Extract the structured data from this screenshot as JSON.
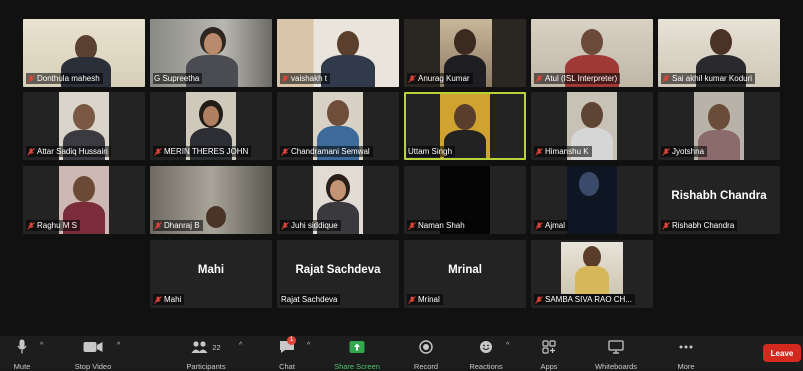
{
  "participants": [
    {
      "name": "Donthula mahesh",
      "muted": true
    },
    {
      "name": "G Supreetha",
      "muted": false
    },
    {
      "name": "vaishakh t",
      "muted": true
    },
    {
      "name": "Anurag Kumar",
      "muted": true
    },
    {
      "name": "Atul (ISL Interpreter)",
      "muted": true
    },
    {
      "name": "Sai akhil kumar Koduri",
      "muted": true
    },
    {
      "name": "Attar Sadiq Hussain",
      "muted": true
    },
    {
      "name": "MERIN THERES JOHN",
      "muted": true
    },
    {
      "name": "Chandramani Semwal",
      "muted": true
    },
    {
      "name": "Uttam Singh",
      "muted": false,
      "active_speaker": true
    },
    {
      "name": "Himanshu K",
      "muted": true
    },
    {
      "name": "Jyotshna",
      "muted": true
    },
    {
      "name": "Raghu M S",
      "muted": true
    },
    {
      "name": "Dhanraj B",
      "muted": true
    },
    {
      "name": "Juhi siddique",
      "muted": true
    },
    {
      "name": "Naman Shah",
      "muted": true
    },
    {
      "name": "Ajmal",
      "muted": true
    },
    {
      "name": "Rishabh Chandra",
      "muted": true,
      "video_off": true,
      "display": "Rishabh Chandra"
    },
    {
      "name": "Mahi",
      "muted": true,
      "video_off": true,
      "display": "Mahi"
    },
    {
      "name": "Rajat Sachdeva",
      "muted": false,
      "video_off": true,
      "display": "Rajat Sachdeva"
    },
    {
      "name": "Mrinal",
      "muted": true,
      "video_off": true,
      "display": "Mrinal"
    },
    {
      "name": "SAMBA SIVA RAO CH...",
      "muted": true
    }
  ],
  "toolbar": {
    "mute": "Mute",
    "stop_video": "Stop Video",
    "participants": "Participants",
    "participants_count": "22",
    "chat": "Chat",
    "chat_badge": "1",
    "share_screen": "Share Screen",
    "record": "Record",
    "reactions": "Reactions",
    "apps": "Apps",
    "whiteboards": "Whiteboards",
    "more": "More",
    "leave": "Leave"
  },
  "colors": {
    "active_border": "#b9d23a",
    "leave": "#d3291f",
    "share_green": "#4cc26a",
    "muted_red": "#e0453a"
  }
}
